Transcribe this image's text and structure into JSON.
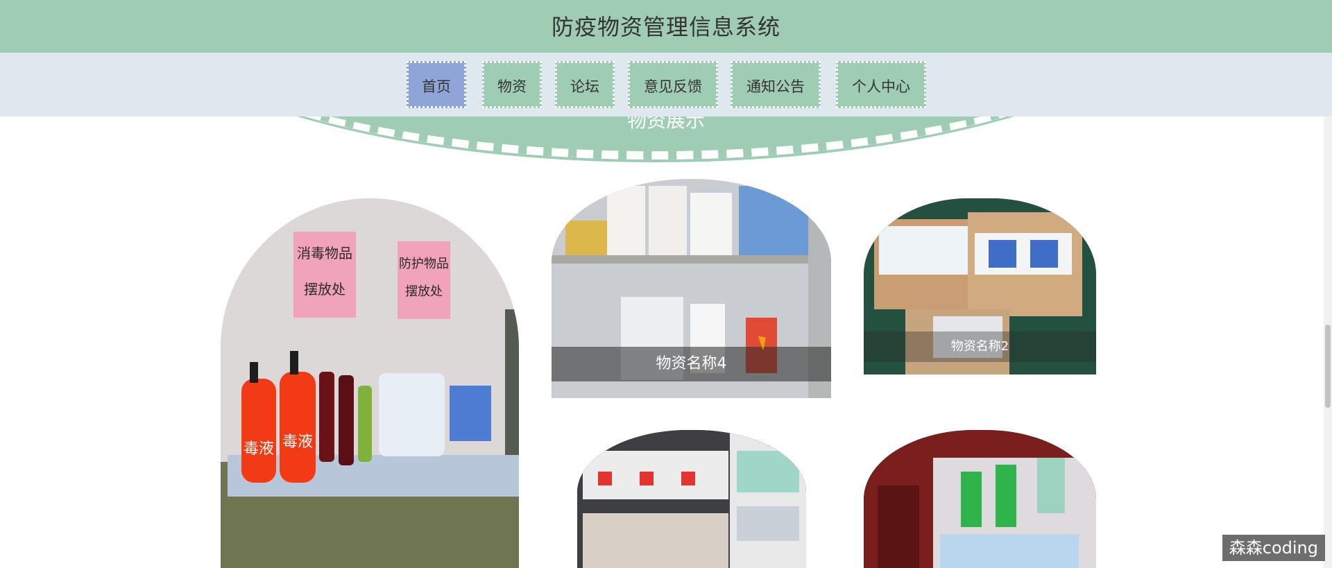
{
  "app": {
    "title": "防疫物资管理信息系统"
  },
  "nav": {
    "items": [
      {
        "label": "首页",
        "active": true
      },
      {
        "label": "物资",
        "active": false
      },
      {
        "label": "论坛",
        "active": false
      },
      {
        "label": "意见反馈",
        "active": false
      },
      {
        "label": "通知公告",
        "active": false
      },
      {
        "label": "个人中心",
        "active": false
      }
    ]
  },
  "section": {
    "title": "物资展示"
  },
  "products": [
    {
      "caption": ""
    },
    {
      "caption": "物资名称4"
    },
    {
      "caption": "物资名称2"
    },
    {
      "caption": ""
    },
    {
      "caption": ""
    }
  ],
  "photo_signs": {
    "sign_left": "消毒物品 摆放处",
    "sign_right": "防护物品 摆放处",
    "bottle_label": "毒液"
  },
  "watermark": "森森coding",
  "colors": {
    "header_bg": "#9fcdb4",
    "nav_bg": "#dfe8ef",
    "nav_active": "#8fa5d8"
  }
}
